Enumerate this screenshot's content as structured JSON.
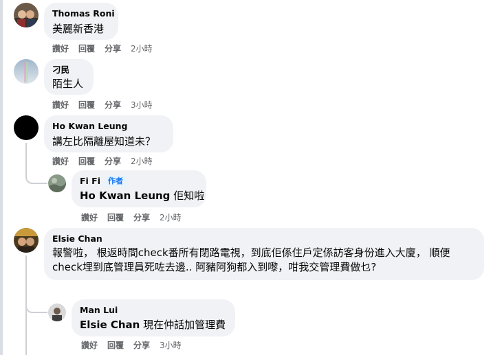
{
  "actions": {
    "like": "讚好",
    "reply": "回覆",
    "share": "分享"
  },
  "comments": [
    {
      "author": "Thomas Roni",
      "text": "美麗新香港",
      "time": "2小時"
    },
    {
      "author": "刁民",
      "text": "陌生人",
      "time": "3小時"
    },
    {
      "author": "Ho Kwan Leung",
      "text": "講左比隔離屋知道未？",
      "time": "2小時"
    },
    {
      "author": "Fi Fi",
      "badge": "作者",
      "mention": "Ho Kwan Leung",
      "text": " 佢知啦",
      "time": "2小時"
    },
    {
      "author": "Elsie Chan",
      "text": "報警啦，  根返時間check番所有閉路電視，到底佢係住戶定係訪客身份進入大廈，  順便check埋到底管理員死咗去邊.. 阿豬阿狗都入到嚟，咁我交管理費做乜?",
      "time": ""
    },
    {
      "author": "Man Lui",
      "mention": "Elsie Chan",
      "text": " 現在仲話加管理費",
      "time": "3小時"
    }
  ]
}
